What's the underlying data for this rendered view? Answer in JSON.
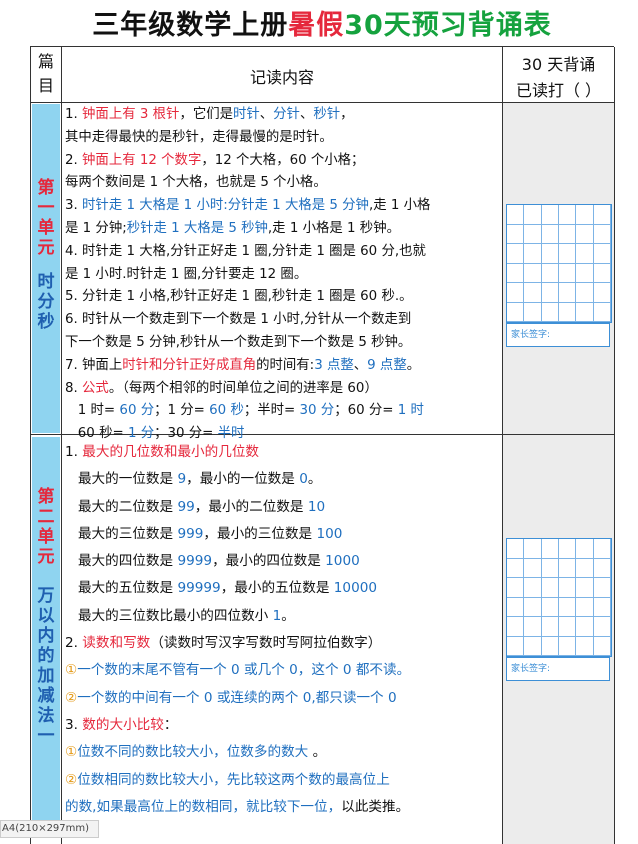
{
  "title": {
    "part1": "三年级数学上册",
    "part2": "暑假",
    "part3": "30天预习背诵表"
  },
  "header": {
    "col1_line1": "篇",
    "col1_line2": "目",
    "col2": "记读内容",
    "col3_line1": "30 天背诵",
    "col3_line2": "已读打（    ）"
  },
  "unit1": {
    "label_top": [
      "第",
      "一",
      "单",
      "元"
    ],
    "label_bottom": [
      "时",
      "分",
      "秒"
    ],
    "lines": [
      [
        [
          "1. ",
          ""
        ],
        [
          "钟面上有 3 根针",
          "r"
        ],
        [
          "，它们是",
          ""
        ],
        [
          "时针",
          "b"
        ],
        [
          "、",
          ""
        ],
        [
          "分针",
          "b"
        ],
        [
          "、",
          ""
        ],
        [
          "秒针",
          "b"
        ],
        [
          "，",
          ""
        ]
      ],
      [
        [
          "其中走得最快的是秒针，走得最慢的是时针。",
          ""
        ]
      ],
      [
        [
          "2. ",
          ""
        ],
        [
          "钟面上有 12 个数字",
          "r"
        ],
        [
          "，12 个大格，60 个小格；",
          ""
        ]
      ],
      [
        [
          "每两个数间是 1 个大格，也就是 5 个小格。",
          ""
        ]
      ],
      [
        [
          "3. ",
          ""
        ],
        [
          "时针走 1 大格是 1 小时:分针走 1 大格是 5 分钟",
          "b"
        ],
        [
          ",走 1 小格",
          ""
        ]
      ],
      [
        [
          "是 1 分钟;",
          ""
        ],
        [
          "秒针走 1 大格是 5 秒钟",
          "b"
        ],
        [
          ",走 1 小格是 1 秒钟。",
          ""
        ]
      ],
      [
        [
          "4. 时针走 1 大格,分针正好走 1 圈,分针走 1 圈是 60 分,也就",
          ""
        ]
      ],
      [
        [
          "是 1 小时.时针走 1 圈,分针要走 12 圈。",
          ""
        ]
      ],
      [
        [
          "5. 分针走 1 小格,秒针正好走 1 圈,秒针走 1 圈是 60 秒.。",
          ""
        ]
      ],
      [
        [
          "6. 时针从一个数走到下一个数是 1 小时,分针从一个数走到",
          ""
        ]
      ],
      [
        [
          "下一个数是 5 分钟,秒针从一个数走到下一个数是 5 秒钟。",
          ""
        ]
      ],
      [
        [
          "7. 钟面上",
          ""
        ],
        [
          "时针和分针正好成直角",
          "r"
        ],
        [
          "的时间有:",
          ""
        ],
        [
          "3 点整",
          "b"
        ],
        [
          "、",
          ""
        ],
        [
          "9 点整",
          "b"
        ],
        [
          "。",
          ""
        ]
      ],
      [
        [
          "8. ",
          ""
        ],
        [
          "公式",
          "r"
        ],
        [
          "。（每两个相邻的时间单位之间的进率是 60）",
          ""
        ]
      ],
      [
        [
          "   1 时= ",
          ""
        ],
        [
          "60 分",
          "b"
        ],
        [
          "；1 分= ",
          ""
        ],
        [
          "60 秒",
          "b"
        ],
        [
          "；半时= ",
          ""
        ],
        [
          "30 分",
          "b"
        ],
        [
          "；60 分= ",
          ""
        ],
        [
          "1 时",
          "b"
        ]
      ],
      [
        [
          "   60 秒= ",
          ""
        ],
        [
          "1 分",
          "b"
        ],
        [
          "；30 分= ",
          ""
        ],
        [
          "半时",
          "b"
        ]
      ]
    ]
  },
  "unit2": {
    "label_top": [
      "第",
      "二",
      "单",
      "元"
    ],
    "label_bottom": [
      "万",
      "以",
      "内",
      "的",
      "加",
      "减",
      "法",
      "一"
    ],
    "lines": [
      [
        [
          "1. ",
          ""
        ],
        [
          "最大的几位数和最小的几位数",
          "r"
        ]
      ],
      [
        [
          "   最大的一位数是 ",
          ""
        ],
        [
          "9",
          "b"
        ],
        [
          "，最小的一位数是 ",
          ""
        ],
        [
          "0",
          "b"
        ],
        [
          "。",
          ""
        ]
      ],
      [
        [
          "   最大的二位数是 ",
          ""
        ],
        [
          "99",
          "b"
        ],
        [
          "，最小的二位数是 ",
          ""
        ],
        [
          "10",
          "b"
        ]
      ],
      [
        [
          "   最大的三位数是 ",
          ""
        ],
        [
          "999",
          "b"
        ],
        [
          "，最小的三位数是 ",
          ""
        ],
        [
          "100",
          "b"
        ]
      ],
      [
        [
          "   最大的四位数是 ",
          ""
        ],
        [
          "9999",
          "b"
        ],
        [
          "，最小的四位数是 ",
          ""
        ],
        [
          "1000",
          "b"
        ]
      ],
      [
        [
          "   最大的五位数是 ",
          ""
        ],
        [
          "99999",
          "b"
        ],
        [
          "，最小的五位数是 ",
          ""
        ],
        [
          "10000",
          "b"
        ]
      ],
      [
        [
          "   最大的三位数比最小的四位数小 ",
          ""
        ],
        [
          "1",
          "b"
        ],
        [
          "。",
          ""
        ]
      ],
      [
        [
          "2. ",
          ""
        ],
        [
          "读数和写数",
          "r"
        ],
        [
          "（读数时写汉字写数时写阿拉伯数字）",
          ""
        ]
      ],
      [
        [
          "①",
          "circ"
        ],
        [
          "一个数的末尾不管有一个 0 或几个 0，这个 0 都不读。",
          "b"
        ]
      ],
      [
        [
          "②",
          "circ"
        ],
        [
          "一个数的中间有一个 0 或连续的两个 0,都只读一个 0",
          "b"
        ]
      ],
      [
        [
          "3. ",
          ""
        ],
        [
          "数的大小比较",
          "r"
        ],
        [
          "：",
          ""
        ]
      ],
      [
        [
          "①",
          "circ"
        ],
        [
          "位数不同的数比较大小，位数多的数大",
          "b"
        ],
        [
          " 。",
          ""
        ]
      ],
      [
        [
          "②",
          "circ"
        ],
        [
          "位数相同的数比较大小，先比较这两个数的最高位上",
          "b"
        ]
      ],
      [
        [
          "的数,如果最高位上的数相同，就比较下一位，",
          "b"
        ],
        [
          "以此类推。",
          ""
        ]
      ]
    ]
  },
  "sign_label": "家长签字:",
  "status_text": "A4(210×297mm)"
}
